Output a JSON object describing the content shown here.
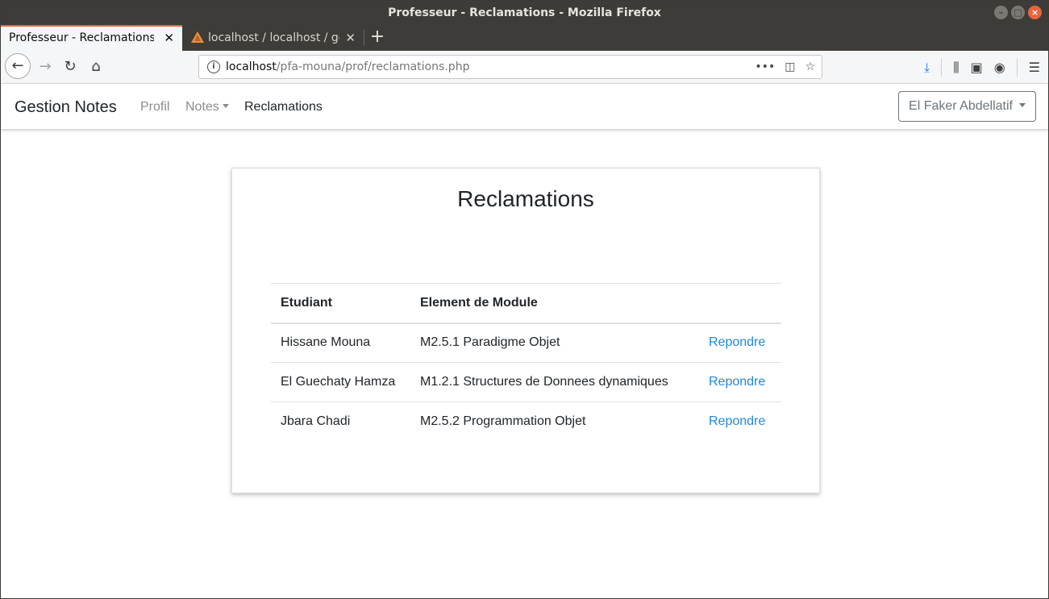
{
  "window": {
    "title": "Professeur - Reclamations - Mozilla Firefox"
  },
  "tabs": [
    {
      "label": "Professeur - Reclamations",
      "active": true
    },
    {
      "label": "localhost / localhost / gestion",
      "active": false
    }
  ],
  "urlbar": {
    "host": "localhost",
    "path": "/pfa-mouna/prof/reclamations.php"
  },
  "site": {
    "brand": "Gestion Notes",
    "nav": {
      "profil": "Profil",
      "notes": "Notes",
      "reclamations": "Reclamations"
    },
    "user": "El Faker Abdellatif"
  },
  "card": {
    "title": "Reclamations",
    "headers": [
      "Etudiant",
      "Element de Module",
      ""
    ],
    "rows": [
      {
        "etudiant": "Hissane Mouna",
        "element": "M2.5.1 Paradigme Objet",
        "action": "Repondre"
      },
      {
        "etudiant": "El Guechaty Hamza",
        "element": "M1.2.1 Structures de Donnees dynamiques",
        "action": "Repondre"
      },
      {
        "etudiant": "Jbara Chadi",
        "element": "M2.5.2 Programmation Objet",
        "action": "Repondre"
      }
    ]
  },
  "colors": {
    "link": "#1e87e0",
    "tab_accent": "#e9653b",
    "titlebar": "#3e3c38"
  }
}
